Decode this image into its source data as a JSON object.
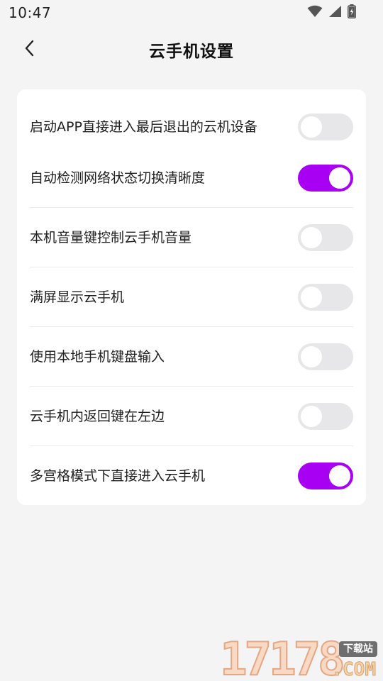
{
  "status_bar": {
    "time": "10:47",
    "icons": [
      "wifi-icon",
      "cellular-signal-icon",
      "battery-charging-icon"
    ]
  },
  "header": {
    "back_icon": "chevron-left-icon",
    "title": "云手机设置"
  },
  "colors": {
    "accent": "#a700f2",
    "toggle_off": "#e7e7e9",
    "background": "#f4f4f5",
    "card": "#ffffff"
  },
  "settings": [
    {
      "label": "启动APP直接进入最后退出的云机设备",
      "enabled": false
    },
    {
      "label": "自动检测网络状态切换清晰度",
      "enabled": true
    },
    {
      "label": "本机音量键控制云手机音量",
      "enabled": false
    },
    {
      "label": "满屏显示云手机",
      "enabled": false
    },
    {
      "label": "使用本地手机键盘输入",
      "enabled": false
    },
    {
      "label": "云手机内返回键在左边",
      "enabled": false
    },
    {
      "label": "多宫格模式下直接进入云手机",
      "enabled": true
    }
  ],
  "watermark": {
    "digits": "17178",
    "badge": "下载站",
    "suffix": ".COM"
  }
}
